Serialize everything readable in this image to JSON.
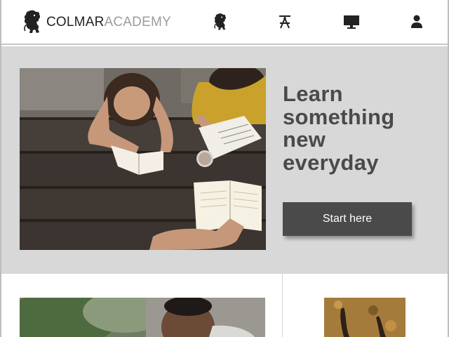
{
  "header": {
    "brand_part1": "COLMAR",
    "brand_part2": "ACADEMY",
    "nav_icons": [
      "lion-icon",
      "compass-icon",
      "monitor-icon",
      "user-icon"
    ]
  },
  "hero": {
    "title_lines": [
      "Learn",
      "something",
      "new",
      "everyday"
    ],
    "cta_label": "Start here",
    "photo": "students-studying-at-picnic-table"
  },
  "below": {
    "photo_1": "student-portrait",
    "photo_2": "autumn-leaves-shadows"
  },
  "colors": {
    "hero_bg": "#d8d8d8",
    "title": "#4a4a4a",
    "button_bg": "#4a4a4a",
    "button_text": "#ffffff",
    "brand_dark": "#222222",
    "brand_light": "#9c9c9c"
  }
}
